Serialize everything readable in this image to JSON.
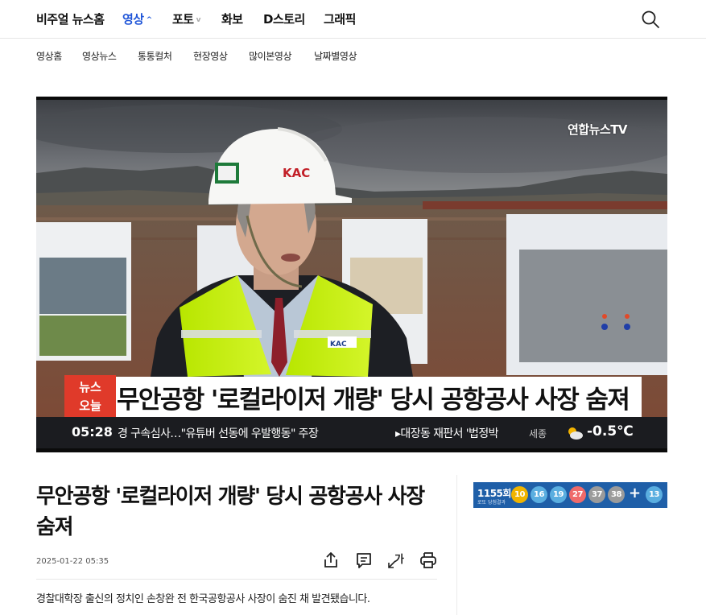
{
  "nav": {
    "items": [
      {
        "label": "비주얼 뉴스홈",
        "active": false
      },
      {
        "label": "영상",
        "active": true,
        "caret": "^"
      },
      {
        "label": "포토",
        "active": false,
        "caret": "v"
      },
      {
        "label": "화보",
        "active": false
      },
      {
        "label": "D스토리",
        "active": false
      },
      {
        "label": "그래픽",
        "active": false
      }
    ],
    "search_icon": "search-icon"
  },
  "subnav": {
    "items": [
      "영상홈",
      "영상뉴스",
      "통통컬처",
      "현장영상",
      "많이본영상",
      "날짜별영상"
    ]
  },
  "video": {
    "channel_logo": "연합뉴스TV",
    "badge_line1": "뉴스",
    "badge_line2": "오늘",
    "lower_third": "무안공항 '로컬라이저 개량' 당시 공항공사 사장 숨져",
    "ticker_time": "05:28",
    "ticker_text1": "경 구속심사…\"유튜버 선동에 우발행동\" 주장",
    "ticker_text2": "▸대장동 재판서 '법정박",
    "weather_city": "세종",
    "weather_temp": "-0.5℃",
    "helmet_text": "KAC",
    "vest_text": "KAC",
    "colors": {
      "badge": "#e03a2a",
      "ticker_bg": "#1b1c20"
    }
  },
  "article": {
    "title": "무안공항 '로컬라이저 개량' 당시 공항공사 사장 숨져",
    "datetime": "2025-01-22 05:35",
    "tools": [
      "share-icon",
      "comment-icon",
      "font-size-icon",
      "print-icon"
    ],
    "font_size_label": "가",
    "summary": "경찰대학장 출신의 정치인 손창완 전 한국공항공사 사장이 숨진 채 발견됐습니다."
  },
  "lotto": {
    "round": "1155회",
    "subtitle": "로또 당첨결과",
    "numbers": [
      {
        "value": "10",
        "color": "#f0b400"
      },
      {
        "value": "16",
        "color": "#5aaee0"
      },
      {
        "value": "19",
        "color": "#5aaee0"
      },
      {
        "value": "27",
        "color": "#ef6a6a"
      },
      {
        "value": "37",
        "color": "#9b9b9b"
      },
      {
        "value": "38",
        "color": "#9b9b9b"
      }
    ],
    "plus": "+",
    "bonus": {
      "value": "13",
      "color": "#5aaee0"
    }
  }
}
